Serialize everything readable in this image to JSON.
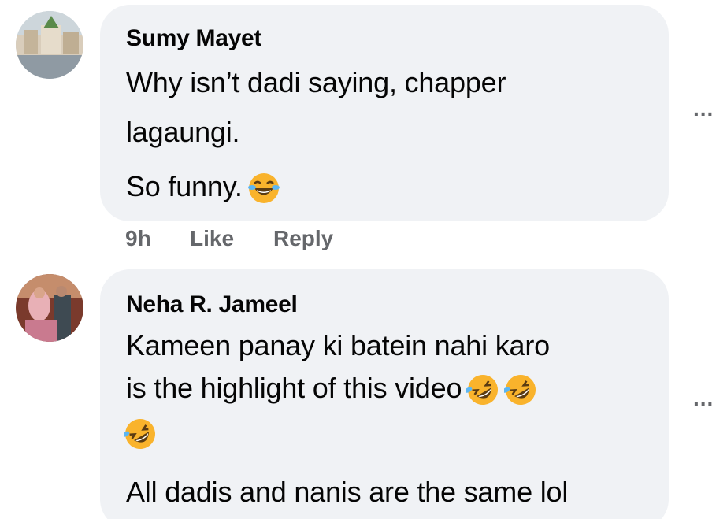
{
  "comments": [
    {
      "author": "Sumy Mayet",
      "lines": [
        "Why isn’t dadi saying, chapper",
        "lagaungi."
      ],
      "line3": "So funny.",
      "emoji": "face-with-tears-of-joy",
      "time": "9h",
      "like_label": "Like",
      "reply_label": "Reply",
      "more_label": "..."
    },
    {
      "author": "Neha R. Jameel",
      "lines": [
        "Kameen panay ki batein nahi karo",
        "is the highlight of this video"
      ],
      "emojis_after_line2": [
        "rolling-on-the-floor-laughing",
        "rolling-on-the-floor-laughing"
      ],
      "emoji_line": [
        "rolling-on-the-floor-laughing"
      ],
      "line4": "All dadis and nanis are the same lol",
      "more_label": "..."
    }
  ],
  "colors": {
    "bubble": "#f0f2f5",
    "text": "#050505",
    "secondary": "#65676b",
    "emoji_yellow": "#f9b32c"
  }
}
